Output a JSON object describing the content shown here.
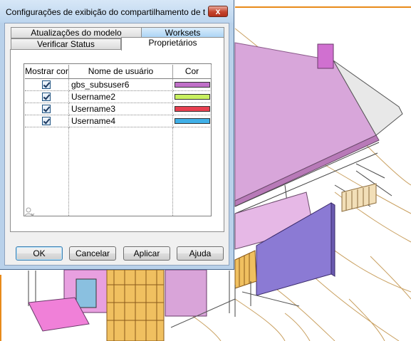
{
  "dialog": {
    "title": "Configurações de exibição do compartilhamento de tr...",
    "close_symbol": "x"
  },
  "tabs": {
    "row1": [
      {
        "label": "Atualizações do modelo"
      },
      {
        "label": "Worksets"
      }
    ],
    "row2": [
      {
        "label": "Verificar Status"
      },
      {
        "label": "Proprietários"
      }
    ],
    "active": "Proprietários"
  },
  "grid": {
    "columns": [
      "Mostrar cor",
      "Nome de usuário",
      "Cor"
    ],
    "rows": [
      {
        "checked": true,
        "username": "gbs_subsuser6",
        "color": "#c070c8"
      },
      {
        "checked": true,
        "username": "Username2",
        "color": "#c8f060"
      },
      {
        "checked": true,
        "username": "Username3",
        "color": "#e84050"
      },
      {
        "checked": true,
        "username": "Username4",
        "color": "#40b0e8"
      }
    ]
  },
  "icons": {
    "close": "close-icon",
    "remove_user": "remove-user-icon",
    "checkbox": "checkmark-icon"
  },
  "buttons": {
    "ok": "OK",
    "cancel": "Cancelar",
    "apply": "Aplicar",
    "help": "Ajuda"
  },
  "colors": {
    "dialog_frame": "#b9d1ea",
    "workset_tab": "#a9d3f5",
    "model_magenta": "#d9a4d9",
    "model_purple": "#8a7ad0",
    "model_frame": "#f0c060"
  }
}
